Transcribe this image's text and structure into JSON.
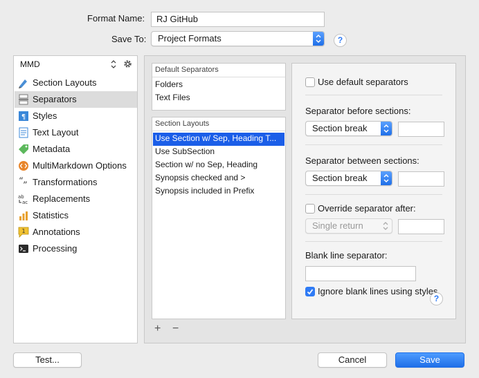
{
  "header": {
    "format_name_label": "Format Name:",
    "format_name_value": "RJ GitHub",
    "save_to_label": "Save To:",
    "save_to_value": "Project Formats",
    "help_glyph": "?"
  },
  "sidebar": {
    "header_label": "MMD",
    "items": [
      {
        "label": "Section Layouts",
        "icon": "section-layouts-icon"
      },
      {
        "label": "Separators",
        "icon": "separators-icon",
        "selected": true
      },
      {
        "label": "Styles",
        "icon": "styles-icon"
      },
      {
        "label": "Text Layout",
        "icon": "text-layout-icon"
      },
      {
        "label": "Metadata",
        "icon": "metadata-tag-icon"
      },
      {
        "label": "MultiMarkdown Options",
        "icon": "code-icon"
      },
      {
        "label": "Transformations",
        "icon": "quote-icon"
      },
      {
        "label": "Replacements",
        "icon": "replacements-icon"
      },
      {
        "label": "Statistics",
        "icon": "bar-chart-icon"
      },
      {
        "label": "Annotations",
        "icon": "annotation-icon"
      },
      {
        "label": "Processing",
        "icon": "terminal-icon"
      }
    ]
  },
  "default_separators": {
    "title": "Default Separators",
    "items": [
      "Folders",
      "Text Files"
    ]
  },
  "section_layouts": {
    "title": "Section Layouts",
    "items": [
      "Use Section w/ Sep, Heading T...",
      "Use SubSection",
      "Section w/ no Sep, Heading",
      "Synopsis checked and >",
      "Synopsis included in Prefix"
    ],
    "selected_index": 0,
    "add_glyph": "+",
    "remove_glyph": "−"
  },
  "options": {
    "use_default_label": "Use default separators",
    "before_label": "Separator before sections:",
    "before_value": "Section break",
    "between_label": "Separator between sections:",
    "between_value": "Section break",
    "override_label": "Override separator after:",
    "override_value": "Single return",
    "blank_line_label": "Blank line separator:",
    "ignore_blank_label": "Ignore blank lines using styles",
    "help_glyph": "?"
  },
  "footer": {
    "test_label": "Test...",
    "cancel_label": "Cancel",
    "save_label": "Save"
  },
  "colors": {
    "accent": "#1f6fe8",
    "selection": "#1b5ee8",
    "background": "#ececec"
  }
}
